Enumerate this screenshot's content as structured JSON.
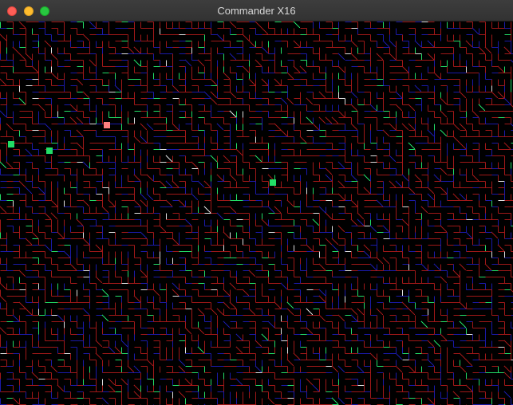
{
  "window": {
    "title": "Commander X16"
  },
  "screen": {
    "description_kind": "maze-pattern",
    "colors": {
      "background": "#000000",
      "wall_red": "#a01818",
      "wall_blue": "#1a1aa8",
      "accent_green": "#22dd66",
      "accent_white": "#e0e0e0",
      "marker_pink": "#ff8080"
    },
    "icons": {
      "close": "close-traffic-light-icon",
      "minimize": "minimize-traffic-light-icon",
      "zoom": "zoom-traffic-light-icon"
    }
  }
}
